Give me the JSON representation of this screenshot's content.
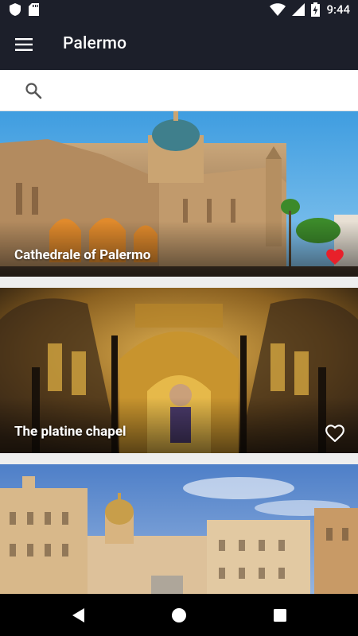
{
  "status_bar": {
    "time": "9:44",
    "icons": [
      "shield-icon",
      "sd-card-icon",
      "wifi-icon",
      "signal-icon",
      "battery-charging-icon"
    ]
  },
  "app_bar": {
    "title": "Palermo",
    "menu_icon": "hamburger-menu-icon"
  },
  "search": {
    "icon": "search-icon",
    "value": "",
    "placeholder": ""
  },
  "places": [
    {
      "name": "Cathedrale of Palermo",
      "favorite": true
    },
    {
      "name": "The platine chapel",
      "favorite": false
    },
    {
      "name": "",
      "favorite": false
    }
  ],
  "colors": {
    "app_bar": "#1c1f2a",
    "favorite_active": "#e8202a",
    "favorite_inactive": "#ffffff",
    "nav_bar": "#000000"
  },
  "nav_bar": {
    "icons": [
      "back-icon",
      "home-icon",
      "recents-icon"
    ]
  }
}
